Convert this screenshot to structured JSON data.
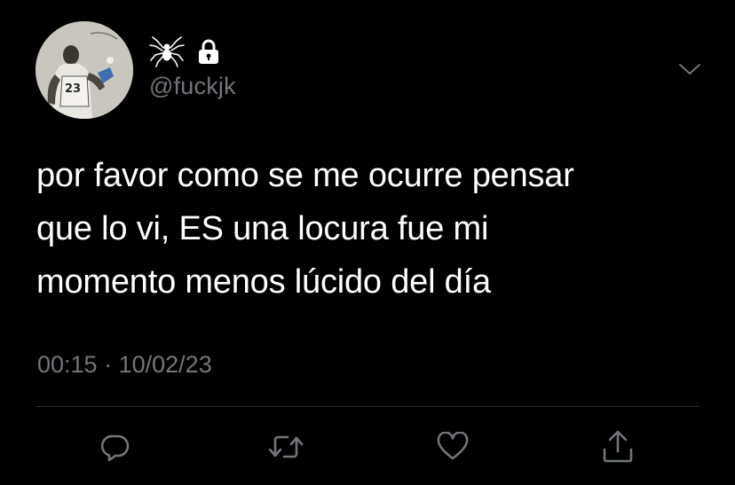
{
  "tweet": {
    "user": {
      "avatar": "avatar-photo",
      "name_icons": [
        "spider-icon",
        "lock-icon"
      ],
      "handle": "@fuckjk"
    },
    "lines": [
      "por favor como se me ocurre pensar",
      "que lo vi, ES una locura fue mi",
      "momento menos lúcido del día"
    ],
    "time": "00:15",
    "separator": "·",
    "date": "10/02/23",
    "actions": [
      "reply-icon",
      "retweet-icon",
      "like-icon",
      "share-icon"
    ]
  },
  "colors": {
    "background": "#000000",
    "text": "#ffffff",
    "secondary": "#71767b",
    "divider": "#2f3336"
  }
}
